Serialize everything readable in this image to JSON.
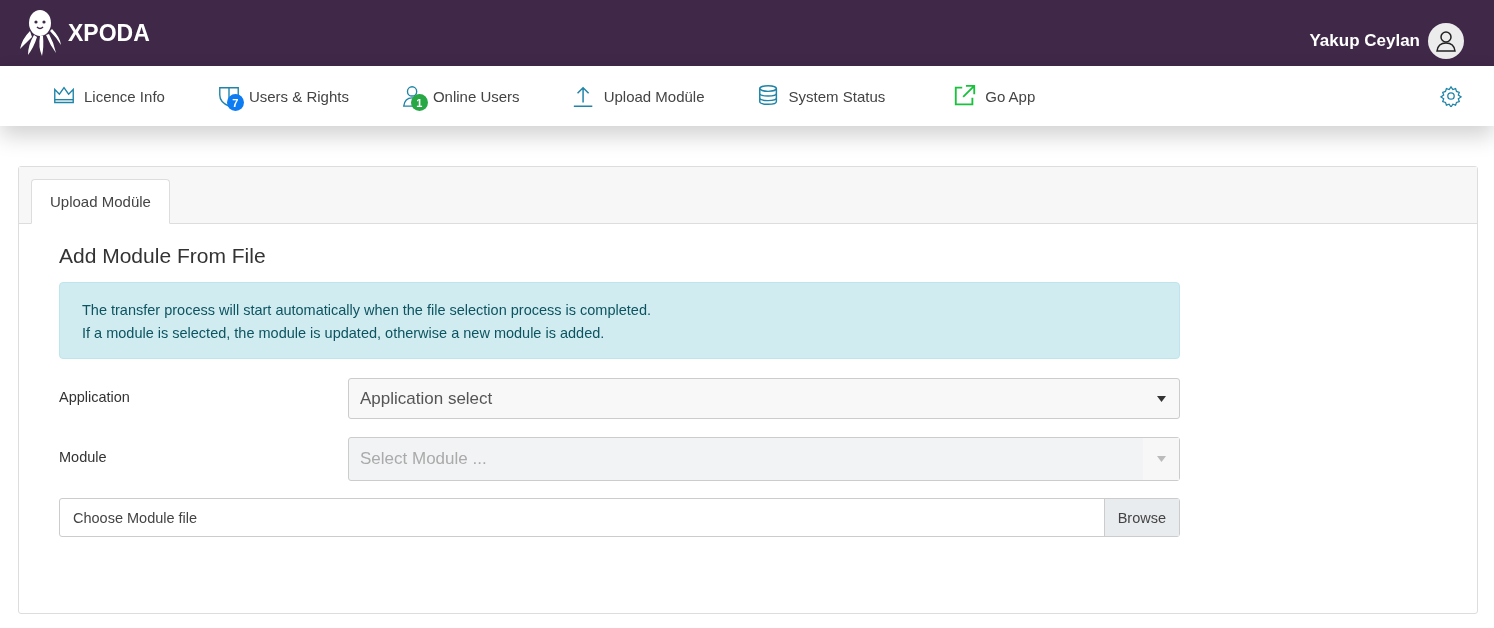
{
  "brand": {
    "name": "XPODA"
  },
  "user": {
    "name": "Yakup Ceylan"
  },
  "nav": [
    {
      "label": "Licence Info",
      "kind": "crown"
    },
    {
      "label": "Users & Rights",
      "kind": "shield",
      "badge": "7",
      "color": "#0d7bf2"
    },
    {
      "label": "Online Users",
      "kind": "user",
      "badge": "1",
      "color": "#28a745"
    },
    {
      "label": "Upload Modüle",
      "kind": "upload"
    },
    {
      "label": "System Status",
      "kind": "database"
    },
    {
      "label": "Go App",
      "kind": "external"
    }
  ],
  "tabs": [
    {
      "label": "Upload Modüle",
      "selected": true
    }
  ],
  "form": {
    "title": "Add Module From File",
    "info": [
      "The transfer process will start automatically when the file selection process is completed.",
      "If a module is selected, the module is updated, otherwise a new module is added."
    ],
    "fields": [
      {
        "label": "Application",
        "placeholder": "Application select",
        "disabled": false
      },
      {
        "label": "Module",
        "placeholder": "Select Module ...",
        "disabled": true
      }
    ],
    "file": {
      "placeholder": "Choose Module file",
      "button": "Browse"
    }
  }
}
